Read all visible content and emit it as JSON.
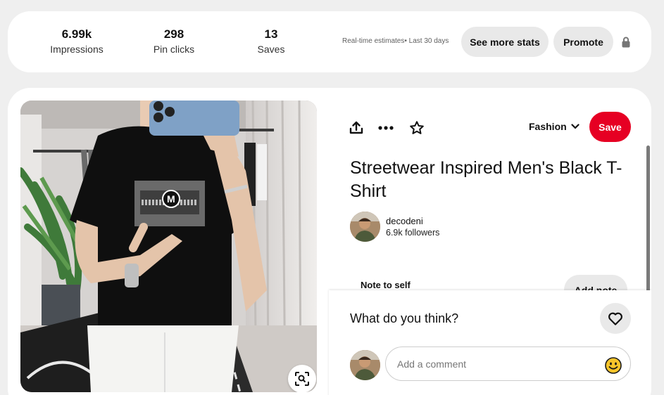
{
  "stats": {
    "items": [
      {
        "value": "6.99k",
        "label": "Impressions"
      },
      {
        "value": "298",
        "label": "Pin clicks"
      },
      {
        "value": "13",
        "label": "Saves"
      }
    ],
    "estimate_note": "Real-time estimates• Last 30 days",
    "see_more_label": "See more stats",
    "promote_label": "Promote",
    "lock_icon": "lock-icon"
  },
  "pin": {
    "title": "Streetwear Inspired Men's Black T-Shirt",
    "board": "Fashion",
    "save_label": "Save",
    "actions": [
      "share-icon",
      "more-icon",
      "star-icon"
    ],
    "lens_icon": "visual-search-icon",
    "creator": {
      "name": "decodeni",
      "followers": "6.9k followers"
    },
    "note_label": "Note to self",
    "add_note_label": "Add note",
    "colors": {
      "save": "#e60023",
      "pill": "#e9e9e9"
    }
  },
  "comments": {
    "prompt": "What do you think?",
    "placeholder": "Add a comment",
    "emoji_icon": "smiley-emoji-icon",
    "heart_icon": "heart-icon"
  }
}
